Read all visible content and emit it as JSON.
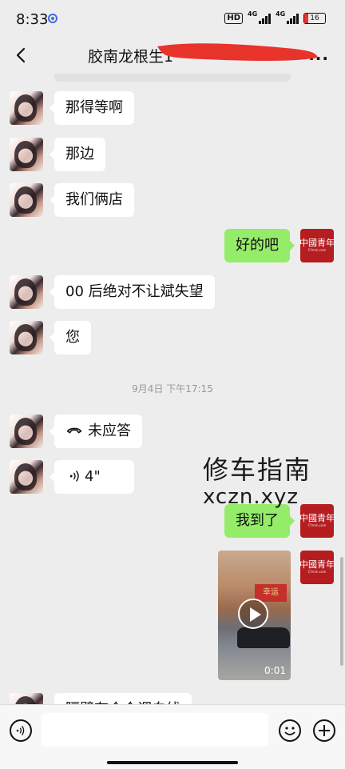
{
  "status_bar": {
    "time": "8:33",
    "hd": "HD",
    "net1": "4G",
    "net2": "4G",
    "battery": "16"
  },
  "header": {
    "title": "胶南龙根生1"
  },
  "messages": [
    {
      "from": "contact",
      "text": "那得等啊"
    },
    {
      "from": "contact",
      "text": "那边"
    },
    {
      "from": "contact",
      "text": "我们俩店"
    },
    {
      "from": "me",
      "text": "好的吧"
    },
    {
      "from": "contact",
      "text": "00 后绝对不让斌失望"
    },
    {
      "from": "contact",
      "text": "您"
    },
    {
      "from": "contact",
      "type": "call",
      "text": "未应答"
    },
    {
      "from": "contact",
      "type": "voice",
      "text": "4\""
    },
    {
      "from": "me",
      "text": "我到了"
    },
    {
      "from": "me",
      "type": "video",
      "duration": "0:01",
      "sign_text": "幸运"
    },
    {
      "from": "contact",
      "text": "隔壁有个个调白线"
    }
  ],
  "timestamp": "9月4日 下午17:15",
  "brand_avatar": {
    "text": "中國青年",
    "sub": "CYmm.com"
  },
  "watermark": {
    "line1": "修车指南",
    "line2": "xczn.xyz"
  },
  "colors": {
    "outgoing_bubble": "#95ec69",
    "incoming_bubble": "#ffffff",
    "background": "#ededed"
  },
  "icons": [
    "back-icon",
    "more-icon",
    "phone-icon",
    "voice-icon",
    "emoji-icon",
    "add-icon",
    "voice-input-icon"
  ]
}
